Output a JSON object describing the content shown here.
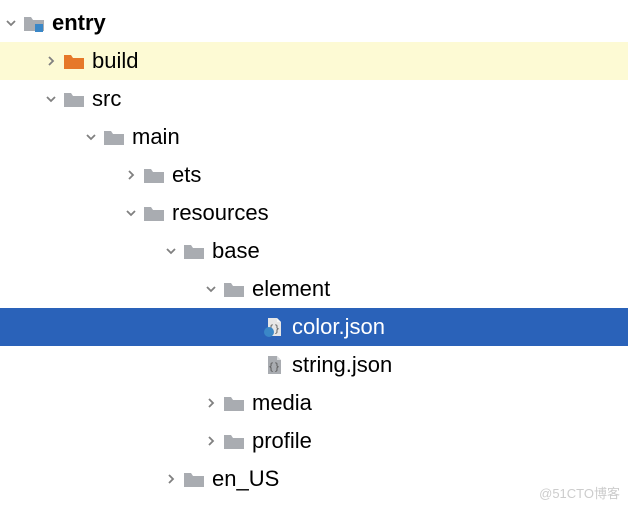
{
  "tree": {
    "items": [
      {
        "label": "entry",
        "depth": 0,
        "expanded": true,
        "hasChildren": true,
        "iconType": "module",
        "bold": true,
        "state": "normal"
      },
      {
        "label": "build",
        "depth": 1,
        "expanded": false,
        "hasChildren": true,
        "iconType": "folder-ex",
        "bold": false,
        "state": "highlighted"
      },
      {
        "label": "src",
        "depth": 1,
        "expanded": true,
        "hasChildren": true,
        "iconType": "folder",
        "bold": false,
        "state": "normal"
      },
      {
        "label": "main",
        "depth": 2,
        "expanded": true,
        "hasChildren": true,
        "iconType": "folder",
        "bold": false,
        "state": "normal"
      },
      {
        "label": "ets",
        "depth": 3,
        "expanded": false,
        "hasChildren": true,
        "iconType": "folder",
        "bold": false,
        "state": "normal"
      },
      {
        "label": "resources",
        "depth": 3,
        "expanded": true,
        "hasChildren": true,
        "iconType": "folder",
        "bold": false,
        "state": "normal"
      },
      {
        "label": "base",
        "depth": 4,
        "expanded": true,
        "hasChildren": true,
        "iconType": "folder",
        "bold": false,
        "state": "normal"
      },
      {
        "label": "element",
        "depth": 5,
        "expanded": true,
        "hasChildren": true,
        "iconType": "folder",
        "bold": false,
        "state": "normal"
      },
      {
        "label": "color.json",
        "depth": 6,
        "expanded": null,
        "hasChildren": false,
        "iconType": "json-color",
        "bold": false,
        "state": "selected"
      },
      {
        "label": "string.json",
        "depth": 6,
        "expanded": null,
        "hasChildren": false,
        "iconType": "json",
        "bold": false,
        "state": "normal"
      },
      {
        "label": "media",
        "depth": 5,
        "expanded": false,
        "hasChildren": true,
        "iconType": "folder",
        "bold": false,
        "state": "normal"
      },
      {
        "label": "profile",
        "depth": 5,
        "expanded": false,
        "hasChildren": true,
        "iconType": "folder",
        "bold": false,
        "state": "normal"
      },
      {
        "label": "en_US",
        "depth": 4,
        "expanded": false,
        "hasChildren": true,
        "iconType": "folder",
        "bold": false,
        "state": "normal"
      }
    ]
  },
  "indentPx": 40,
  "watermark": "@51CTO博客"
}
